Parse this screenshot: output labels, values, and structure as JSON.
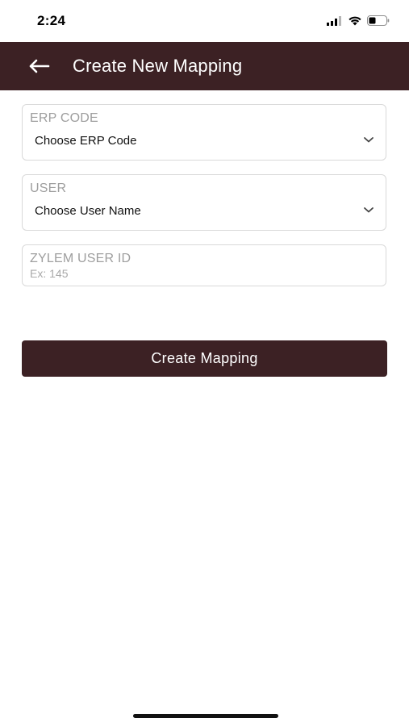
{
  "status_bar": {
    "time": "2:24"
  },
  "app_bar": {
    "back_icon": "arrow-left-icon",
    "title": "Create New Mapping"
  },
  "form": {
    "erp_code": {
      "label": "ERP CODE",
      "value": "Choose ERP Code",
      "icon": "chevron-down-icon"
    },
    "user": {
      "label": "USER",
      "value": "Choose User Name",
      "icon": "chevron-down-icon"
    },
    "zylem_user_id": {
      "label": "ZYLEM USER ID",
      "placeholder": "Ex: 145"
    },
    "submit_label": "Create Mapping"
  },
  "colors": {
    "brand": "#3c2124",
    "border": "#d9d9d9",
    "label": "#9e9e9e"
  }
}
